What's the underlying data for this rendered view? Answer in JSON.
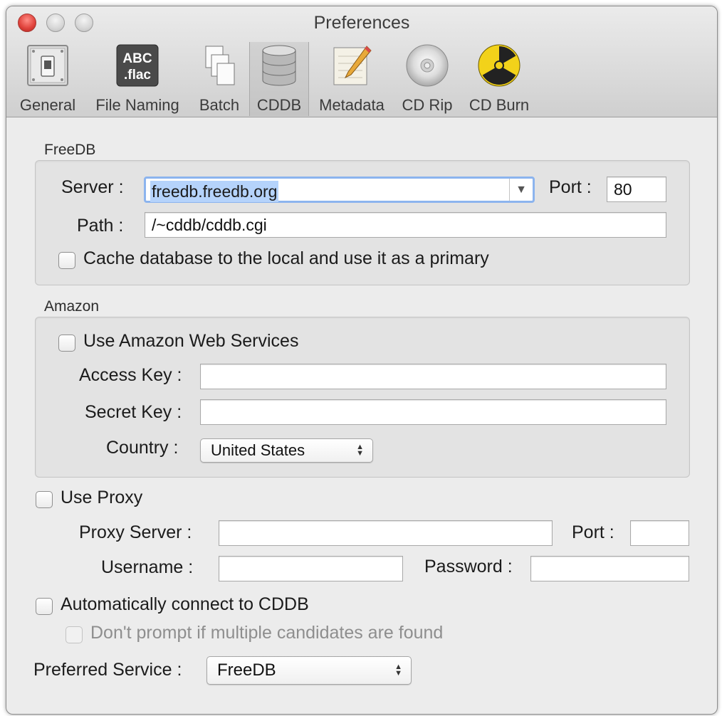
{
  "window": {
    "title": "Preferences"
  },
  "toolbar": {
    "items": [
      {
        "label": "General",
        "icon": "toggle-switch-icon"
      },
      {
        "label": "File Naming",
        "icon": "file-naming-icon",
        "icon_text_line1": "ABC",
        "icon_text_line2": ".flac"
      },
      {
        "label": "Batch",
        "icon": "batch-documents-icon"
      },
      {
        "label": "CDDB",
        "icon": "database-icon",
        "selected": true
      },
      {
        "label": "Metadata",
        "icon": "notepad-pencil-icon"
      },
      {
        "label": "CD Rip",
        "icon": "disc-icon"
      },
      {
        "label": "CD Burn",
        "icon": "radiation-icon"
      }
    ]
  },
  "freedb": {
    "section_label": "FreeDB",
    "server_label": "Server :",
    "server_value": "freedb.freedb.org",
    "port_label": "Port :",
    "port_value": "80",
    "path_label": "Path :",
    "path_value": "/~cddb/cddb.cgi",
    "cache_label": "Cache database to the local and use it as a primary"
  },
  "amazon": {
    "section_label": "Amazon",
    "use_label": "Use Amazon Web Services",
    "access_key_label": "Access Key :",
    "access_key_value": "",
    "secret_key_label": "Secret Key :",
    "secret_key_value": "",
    "country_label": "Country :",
    "country_value": "United States"
  },
  "proxy": {
    "use_label": "Use Proxy",
    "server_label": "Proxy Server :",
    "server_value": "",
    "port_label": "Port :",
    "port_value": "",
    "username_label": "Username :",
    "username_value": "",
    "password_label": "Password :",
    "password_value": ""
  },
  "auto_connect": {
    "label": "Automatically connect to CDDB",
    "no_prompt_label": "Don't prompt if multiple candidates are found"
  },
  "preferred": {
    "label": "Preferred Service :",
    "value": "FreeDB"
  },
  "colors": {
    "focus_ring": "#8cb4ee",
    "selection": "#b5d3fb",
    "close_button": "#e2463f"
  }
}
